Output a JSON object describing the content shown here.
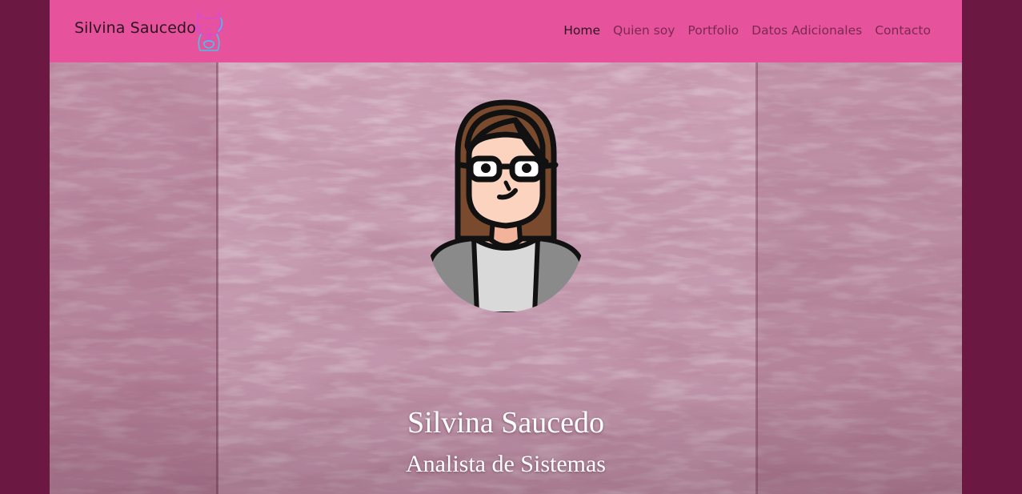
{
  "navbar": {
    "brand": "Silvina Saucedo",
    "logo_icon": "maneki-neko-cat-icon",
    "items": [
      {
        "label": "Home",
        "active": true
      },
      {
        "label": "Quien soy",
        "active": false
      },
      {
        "label": "Portfolio",
        "active": false
      },
      {
        "label": "Datos Adicionales",
        "active": false
      },
      {
        "label": "Contacto",
        "active": false
      }
    ]
  },
  "hero": {
    "name": "Silvina Saucedo",
    "role": "Analista de Sistemas",
    "avatar_icon": "woman-with-glasses-avatar-icon"
  },
  "colors": {
    "page_bg": "#6b1843",
    "navbar_bg": "#e6529c",
    "hero_tint": "#b77a96",
    "text_dark": "#2b1420",
    "text_muted": "#7a2a52",
    "hero_text": "#ffffff"
  }
}
